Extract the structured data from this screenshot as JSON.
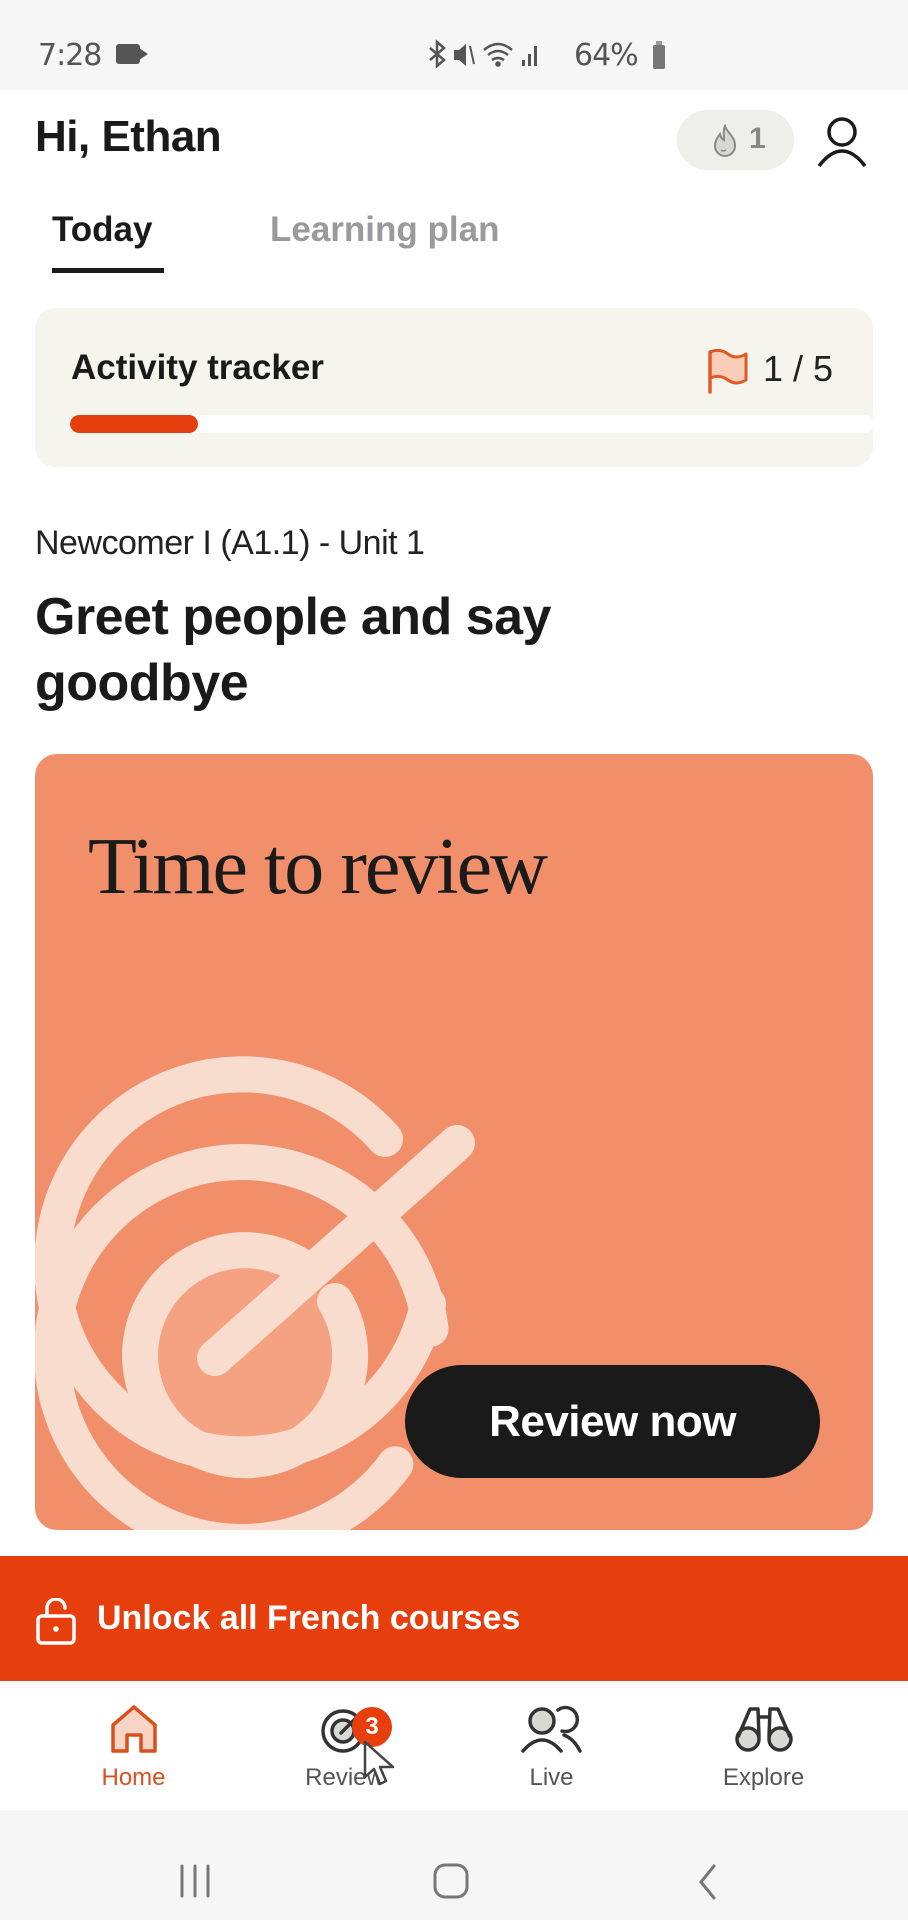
{
  "status_bar": {
    "time": "7:28",
    "icons": "bluetooth, mute, wifi, signal",
    "icon_glyphs": "✻ ♪̸ ≋ .ıl",
    "battery": "64%"
  },
  "header": {
    "greeting": "Hi, Ethan",
    "streak_count": "1",
    "streak_icon": "flame-icon",
    "profile_icon": "user-icon"
  },
  "tabs": [
    {
      "label": "Today",
      "active": true
    },
    {
      "label": "Learning plan",
      "active": false
    }
  ],
  "activity_tracker": {
    "title": "Activity tracker",
    "progress_text": "1 / 5",
    "completed": 1,
    "total": 5,
    "progress_fraction": 0.2
  },
  "unit": {
    "subtitle": "Newcomer I (A1.1) - Unit 1",
    "title": "Greet people and say goodbye"
  },
  "review_card": {
    "heading": "Time to review",
    "button_label": "Review now",
    "background_color": "#f28f6b",
    "graphic": "target-icon"
  },
  "unlock_banner": {
    "label": "Unlock all French courses",
    "color": "#e63e0c"
  },
  "bottom_nav": {
    "items": [
      {
        "label": "Home",
        "icon": "home-icon",
        "active": true
      },
      {
        "label": "Review",
        "icon": "review-target-icon",
        "active": false,
        "badge": "3"
      },
      {
        "label": "Live",
        "icon": "people-icon",
        "active": false
      },
      {
        "label": "Explore",
        "icon": "binoculars-icon",
        "active": false
      }
    ]
  },
  "colors": {
    "accent": "#e63e0c",
    "active_nav": "#d9501c",
    "text": "#1a1a1a",
    "inactive_tab": "#9a9a9e"
  }
}
